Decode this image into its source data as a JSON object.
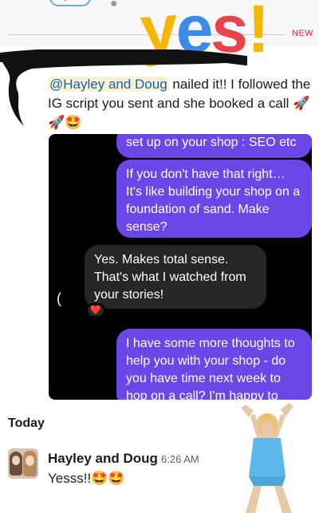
{
  "sticker": {
    "letters": [
      "y",
      "e",
      "s",
      "!"
    ],
    "colors": [
      "#f5b800",
      "#3d8be8",
      "#e8434b",
      "#f5b800"
    ]
  },
  "divider": {
    "new_label": "NEW"
  },
  "message": {
    "mention": "@Hayley and Doug",
    "body": " nailed it!! I followed the IG script you sent and she booked a call",
    "emoji": "🚀🚀🤩"
  },
  "dm_screenshot": {
    "bubbles": [
      {
        "from": "me",
        "text": "set up on your shop : SEO etc"
      },
      {
        "from": "me",
        "text": "If you don't have that right… It's like building your shop on a foundation of sand. Make sense?"
      },
      {
        "from": "them",
        "text": "Yes. Makes total sense. That's what I watched from your stories!"
      },
      {
        "from": "me",
        "text": "I have some more thoughts to help you with your shop - do you have time next week to hop on a call? I'm happy to"
      }
    ],
    "reaction": "❤️"
  },
  "day_label": "Today",
  "reply": {
    "sender": "Hayley and Doug",
    "time": "6:26 AM",
    "text": "Yesss!!",
    "emoji": "🤩🤩"
  },
  "colors": {
    "outgoing_bubble": "#6c47e8",
    "incoming_bubble": "#262626",
    "mention_link": "#1264a3",
    "new_divider": "#e01e5a"
  }
}
